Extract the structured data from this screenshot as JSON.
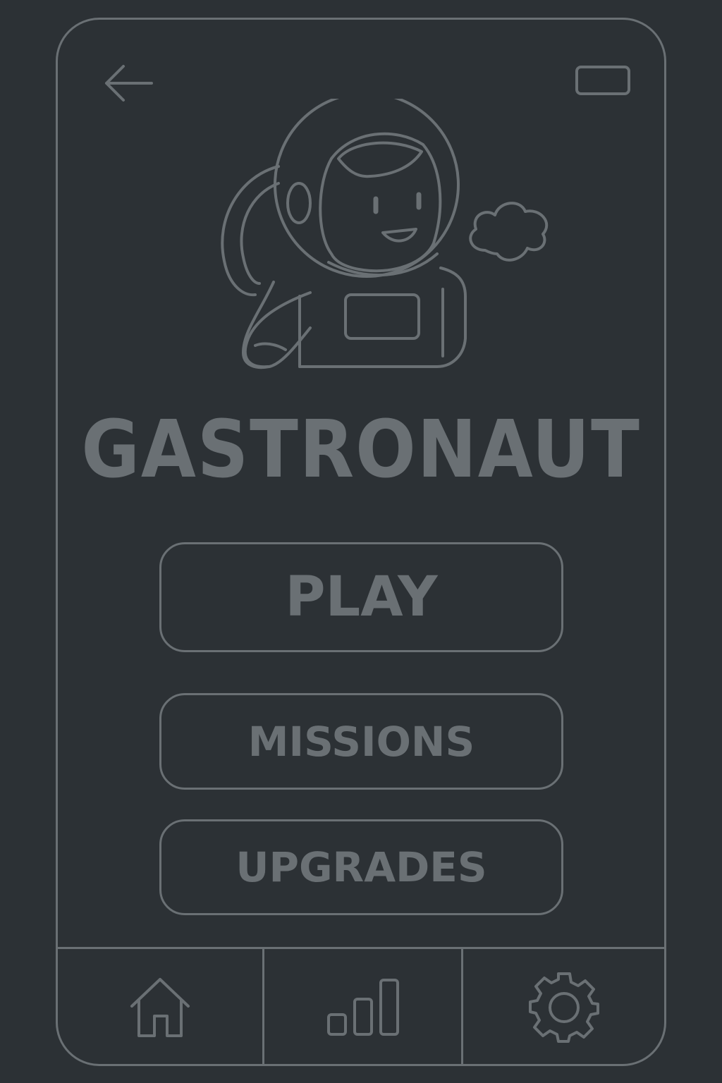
{
  "app": {
    "title": "GASTRONAUT"
  },
  "header": {
    "back_icon": "back-arrow-icon",
    "status_icon": "battery-icon"
  },
  "hero": {
    "illustration": "astronaut-illustration",
    "decoration": "cloud-icon"
  },
  "menu": {
    "play_label": "PLAY",
    "missions_label": "MISSIONS",
    "upgrades_label": "UPGRADES"
  },
  "tabbar": {
    "items": [
      {
        "icon": "home-icon"
      },
      {
        "icon": "bar-chart-icon"
      },
      {
        "icon": "gear-icon"
      }
    ]
  },
  "colors": {
    "background": "#2c3135",
    "stroke": "#6a7074"
  }
}
